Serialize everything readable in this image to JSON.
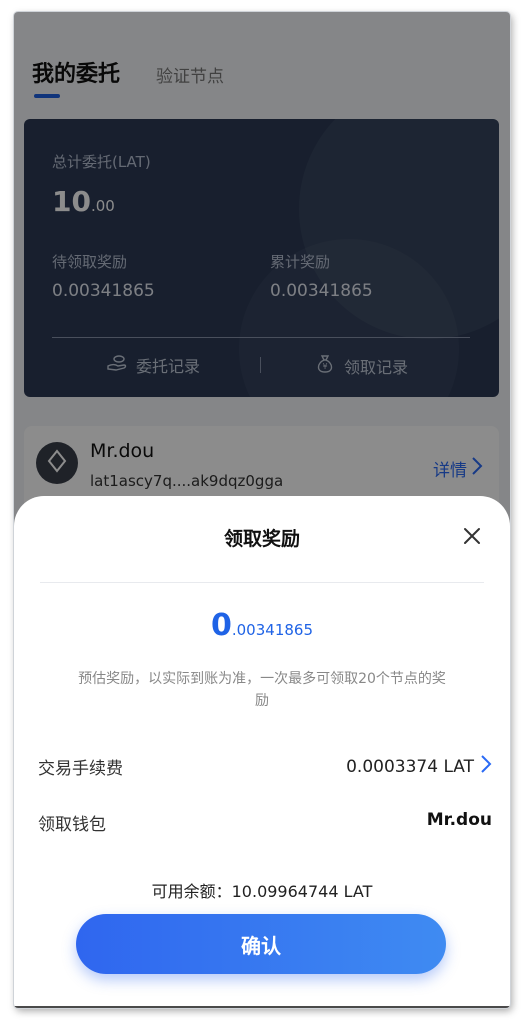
{
  "tabs": {
    "active": "我的委托",
    "inactive": "验证节点"
  },
  "summary": {
    "total_label": "总计委托(LAT)",
    "total_int": "10",
    "total_dec": ".00",
    "pending_label": "待领取奖励",
    "pending_value": "0.00341865",
    "cumulative_label": "累计奖励",
    "cumulative_value": "0.00341865",
    "delegate_records": "委托记录",
    "claim_records": "领取记录"
  },
  "node": {
    "name": "Mr.dou",
    "address": "lat1ascy7q....ak9dqz0gga",
    "detail_label": "详情"
  },
  "sheet": {
    "title": "领取奖励",
    "reward_int": "0",
    "reward_dec": ".00341865",
    "note": "预估奖励，以实际到账为准，一次最多可领取20个节点的奖励",
    "fee_label": "交易手续费",
    "fee_value": "0.0003374 LAT",
    "wallet_label": "领取钱包",
    "wallet_value": "Mr.dou",
    "balance": "可用余额：10.09964744 LAT",
    "confirm_label": "确认"
  },
  "colors": {
    "accent": "#1f63e6",
    "card": "#2c3a55"
  }
}
